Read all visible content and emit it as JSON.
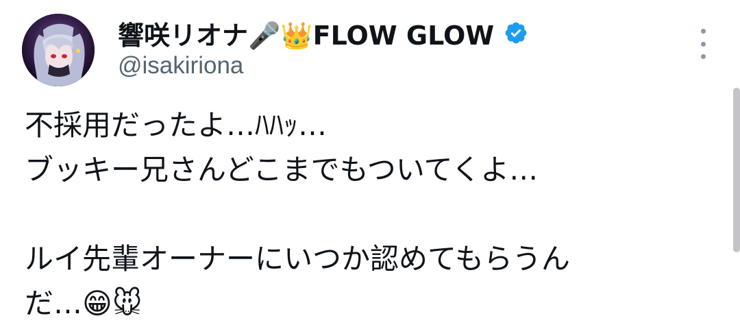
{
  "author": {
    "display_name": "響咲リオナ🎤👑FLOW GLOW",
    "handle": "@isakiriona",
    "verified": true,
    "verified_color": "#1d9bf0"
  },
  "tweet": {
    "text": "不採用だったよ…ﾊﾊｯ…\nブッキー兄さんどこまでもついてくよ…\n\nルイ先輩オーナーにいつか認めてもらうん\nだ…😁🐭"
  },
  "icons": {
    "avatar": "avatar-image",
    "verified": "verified-badge-icon",
    "more": "more-options-icon"
  },
  "colors": {
    "text": "#0f1419",
    "secondary": "#536471"
  }
}
